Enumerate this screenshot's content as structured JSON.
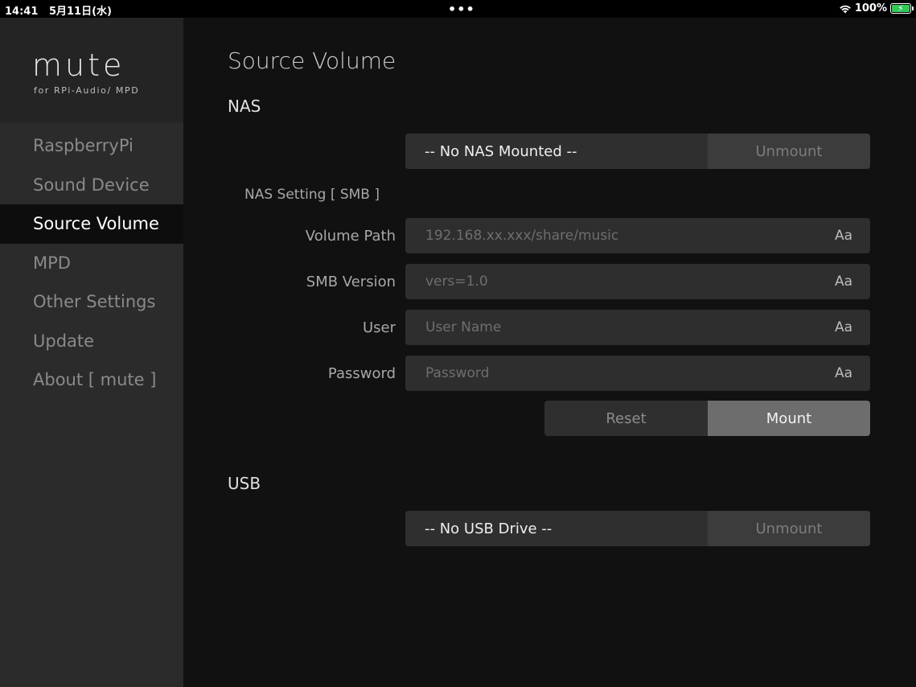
{
  "status_bar": {
    "time": "14:41",
    "date": "5月11日(水)",
    "dots": "•••",
    "battery_percent": "100%",
    "icons": [
      "wifi-icon",
      "battery-charging-icon"
    ],
    "battery_color": "#34c759"
  },
  "sidebar": {
    "logo": "mute",
    "logo_sub": "for RPi-Audio/ MPD",
    "items": [
      {
        "label": "RaspberryPi",
        "active": false
      },
      {
        "label": "Sound Device",
        "active": false
      },
      {
        "label": "Source Volume",
        "active": true
      },
      {
        "label": "MPD",
        "active": false
      },
      {
        "label": "Other Settings",
        "active": false
      },
      {
        "label": "Update",
        "active": false
      },
      {
        "label": "About [ mute ]",
        "active": false
      }
    ]
  },
  "main": {
    "title": "Source Volume",
    "nas": {
      "heading": "NAS",
      "status": "-- No NAS Mounted --",
      "unmount_label": "Unmount",
      "setting_heading": "NAS Setting [ SMB ]",
      "fields": [
        {
          "label": "Volume Path",
          "placeholder": "192.168.xx.xxx/share/music",
          "suffix": "Aa"
        },
        {
          "label": "SMB Version",
          "placeholder": "vers=1.0",
          "suffix": "Aa"
        },
        {
          "label": "User",
          "placeholder": "User Name",
          "suffix": "Aa"
        },
        {
          "label": "Password",
          "placeholder": "Password",
          "suffix": "Aa"
        }
      ],
      "reset_label": "Reset",
      "mount_label": "Mount"
    },
    "usb": {
      "heading": "USB",
      "status": "-- No USB Drive --",
      "unmount_label": "Unmount"
    }
  }
}
